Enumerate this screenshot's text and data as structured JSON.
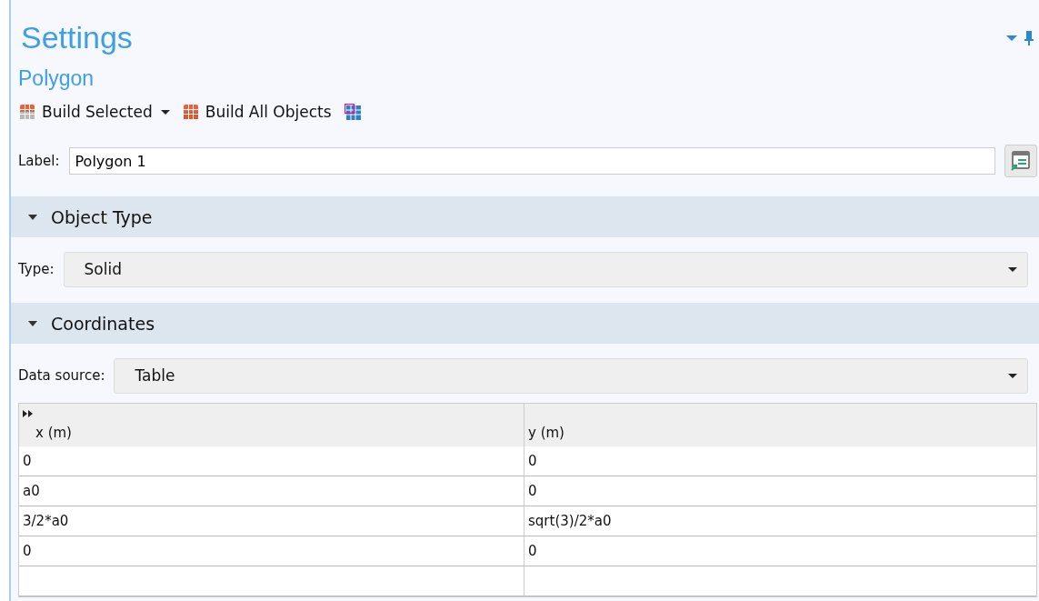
{
  "panel": {
    "title": "Settings",
    "subtitle": "Polygon"
  },
  "toolbar": [
    {
      "kind": "split",
      "label": "Build Selected"
    },
    {
      "kind": "plain",
      "label": "Build All Objects"
    },
    {
      "kind": "icon"
    }
  ],
  "label_field": {
    "label": "Label:",
    "value": "Polygon 1"
  },
  "sections": [
    {
      "title": "Object Type",
      "expanded": true,
      "fields": [
        {
          "label": "Type:",
          "value": "Solid"
        }
      ]
    },
    {
      "title": "Coordinates",
      "expanded": true,
      "fields": [
        {
          "label": "Data source:",
          "value": "Table"
        }
      ],
      "table": {
        "columns": [
          "x (m)",
          "y (m)"
        ],
        "rows": [
          [
            "0",
            "0"
          ],
          [
            "a0",
            "0"
          ],
          [
            "3/2*a0",
            "sqrt(3)/2*a0"
          ],
          [
            "0",
            "0"
          ]
        ]
      }
    }
  ]
}
